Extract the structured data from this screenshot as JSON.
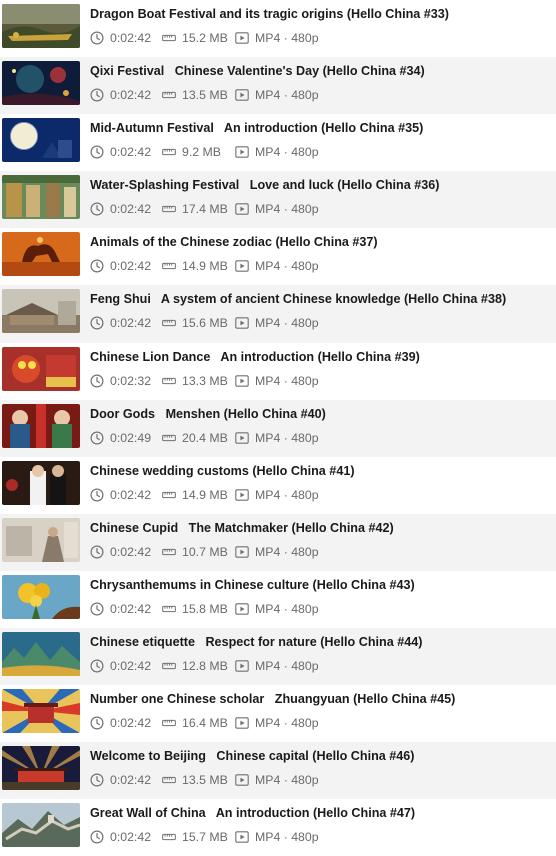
{
  "items": [
    {
      "title": "Dragon Boat Festival and its tragic origins (Hello China #33)",
      "duration": "0:02:42",
      "size": "15.2 MB",
      "format": "MP4 · 480p",
      "thumb": "dragon-boat"
    },
    {
      "title": "Qixi Festival   Chinese Valentine's Day (Hello China #34)",
      "duration": "0:02:42",
      "size": "13.5 MB",
      "format": "MP4 · 480p",
      "thumb": "qixi"
    },
    {
      "title": "Mid-Autumn Festival   An introduction (Hello China #35)",
      "duration": "0:02:42",
      "size": "9.2 MB",
      "format": "MP4 · 480p",
      "thumb": "mid-autumn"
    },
    {
      "title": "Water-Splashing Festival   Love and luck (Hello China #36)",
      "duration": "0:02:42",
      "size": "17.4 MB",
      "format": "MP4 · 480p",
      "thumb": "water-splashing"
    },
    {
      "title": "Animals of the Chinese zodiac (Hello China #37)",
      "duration": "0:02:42",
      "size": "14.9 MB",
      "format": "MP4 · 480p",
      "thumb": "zodiac"
    },
    {
      "title": "Feng Shui   A system of ancient Chinese knowledge (Hello China #38)",
      "duration": "0:02:42",
      "size": "15.6 MB",
      "format": "MP4 · 480p",
      "thumb": "feng-shui"
    },
    {
      "title": "Chinese Lion Dance   An introduction (Hello China #39)",
      "duration": "0:02:32",
      "size": "13.3 MB",
      "format": "MP4 · 480p",
      "thumb": "lion-dance"
    },
    {
      "title": "Door Gods   Menshen (Hello China #40)",
      "duration": "0:02:49",
      "size": "20.4 MB",
      "format": "MP4 · 480p",
      "thumb": "door-gods"
    },
    {
      "title": "Chinese wedding customs (Hello China #41)",
      "duration": "0:02:42",
      "size": "14.9 MB",
      "format": "MP4 · 480p",
      "thumb": "wedding"
    },
    {
      "title": "Chinese Cupid   The Matchmaker (Hello China #42)",
      "duration": "0:02:42",
      "size": "10.7 MB",
      "format": "MP4 · 480p",
      "thumb": "cupid"
    },
    {
      "title": "Chrysanthemums in Chinese culture (Hello China #43)",
      "duration": "0:02:42",
      "size": "15.8 MB",
      "format": "MP4 · 480p",
      "thumb": "chrysanthemum"
    },
    {
      "title": "Chinese etiquette   Respect for nature (Hello China #44)",
      "duration": "0:02:42",
      "size": "12.8 MB",
      "format": "MP4 · 480p",
      "thumb": "etiquette"
    },
    {
      "title": "Number one Chinese scholar   Zhuangyuan (Hello China #45)",
      "duration": "0:02:42",
      "size": "16.4 MB",
      "format": "MP4 · 480p",
      "thumb": "scholar"
    },
    {
      "title": "Welcome to Beijing   Chinese capital (Hello China #46)",
      "duration": "0:02:42",
      "size": "13.5 MB",
      "format": "MP4 · 480p",
      "thumb": "beijing"
    },
    {
      "title": "Great Wall of China   An introduction (Hello China #47)",
      "duration": "0:02:42",
      "size": "15.7 MB",
      "format": "MP4 · 480p",
      "thumb": "great-wall"
    }
  ],
  "icons": {
    "duration": "clock-icon",
    "size": "storage-icon",
    "format": "video-file-icon"
  },
  "colors": {
    "title_text": "#1a1a1a",
    "meta_text": "#6a6a6a",
    "alt_row_bg": "#f3f3f3"
  }
}
